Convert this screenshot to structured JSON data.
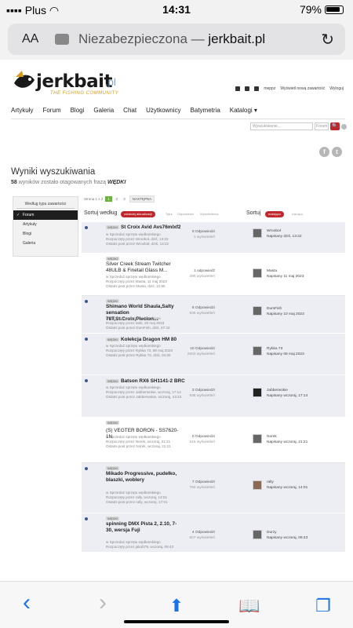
{
  "status": {
    "carrier": "Plus",
    "time": "14:31",
    "battery": "79%"
  },
  "browser": {
    "aa": "AA",
    "url_prefix": "Niezabezpieczona — ",
    "url_domain": "jerkbait.pl"
  },
  "site": {
    "logo": {
      "word": "jerkbait",
      "suffix": ".pl",
      "tagline": "THE FISHING COMMUNITY"
    },
    "toplinks": {
      "user": "meppz",
      "show_new": "Wyświetl nową zawartość",
      "logout": "Wyloguj"
    },
    "nav": [
      "Artykuły",
      "Forum",
      "Blogi",
      "Galeria",
      "Chat",
      "Użytkownicy",
      "Batymetria",
      "Katalogi ▾"
    ],
    "search": {
      "placeholder": "Wyszukiwanie...",
      "scope": "Forum",
      "button": "🔍"
    },
    "social": [
      "f",
      "t"
    ]
  },
  "results": {
    "title": "Wyniki wyszukiwania",
    "count": "58",
    "sub_text": " wyników zostało otagowanych frazą ",
    "phrase": "WĘDKI"
  },
  "filter": {
    "heading": "Według typu zawartości",
    "items": [
      "Forum",
      "Artykuły",
      "Blogi",
      "Galeria"
    ]
  },
  "pager": {
    "label": "Strona 1 z 3",
    "pages": [
      "1",
      "2",
      "3"
    ],
    "next": "NASTĘPNA"
  },
  "sort": {
    "label": "Sortuj według",
    "options": [
      "ostatniej aktualizacji",
      "Tytuł",
      "Odpowiedzi",
      "Wyświetlenia"
    ],
    "label2": "Sortuj",
    "options2": [
      "malejąco",
      "rosnąco"
    ]
  },
  "topics": [
    {
      "tag": "WĘDKI",
      "title": "St Croix Avid Avs76mlxf2",
      "meta": [
        "w Sprzedaż sprzętu wędkarskiego",
        "Rozpoczęty przez Wrooboł, dziś, 13:22",
        "Ostatni post przez Wrooboł, dziś, 13:22"
      ],
      "replies": "0 Odpowiedzi",
      "views": "1 wyświetleń",
      "last_user": "Wrooboł",
      "last_date": "Napisany dziś, 13:22"
    },
    {
      "tag": "WĘDKI",
      "title": "Silver Creek Stream Twitcher 48ULB & Finetail Glass M...",
      "meta": [
        "w Sprzedaż sprzętu wędkarskiego",
        "Rozpoczęty przez Masta, 11 maj 2023",
        "Ostatni post przez Masta, dziś, 12:55"
      ],
      "replies": "1 odpowiedź",
      "views": "490 wyświetleń",
      "last_user": "Masta",
      "last_date": "Napisany 11 maj 2023"
    },
    {
      "tag": "WĘDKI",
      "title": "Shimano World Shaula,Salty sensation 78T,St.Croix,Plecion...",
      "meta": [
        "w Sprzedaż sprzętu wędkarskiego",
        "Rozpoczęty przez tarik, 30 maj 2023",
        "Ostatni post przez DumFish, dziś, 07:43"
      ],
      "replies": "5 Odpowiedzi",
      "views": "935 wyświetleń",
      "last_user": "DumFish",
      "last_date": "Napisany 10 maj 2023"
    },
    {
      "tag": "WĘDKI",
      "title": "Kolekcja Dragon HM 80",
      "meta": [
        "w Sprzedaż sprzętu wędkarskiego",
        "Rozpoczęty przez Rybka 73, 08 maj 2023",
        "Ostatni post przez Rybka 73, dziś, 04:30"
      ],
      "replies": "10 Odpowiedzi",
      "views": "2602 wyświetleń",
      "last_user": "Rybka 73",
      "last_date": "Napisany 08 maj 2023"
    },
    {
      "tag": "WĘDKI",
      "title": "Batson RX6 SH1141-2 BRC",
      "meta": [
        "w Sprzedaż sprzętu wędkarskiego",
        "Rozpoczęty przez Jabberwokie, wczoraj, 17:14",
        "Ostatni post przez Jabberwokie, wczoraj, 23:24"
      ],
      "replies": "3 Odpowiedzi",
      "views": "838 wyświetleń",
      "last_user": "Jabberwokie",
      "last_date": "Napisany wczoraj, 17:14"
    },
    {
      "tag": "WĘDKI",
      "title": "(S) VEGTER BORON - SS7620-1N",
      "meta": [
        "w Sprzedaż sprzętu wędkarskiego",
        "Rozpoczęty przez Norek, wczoraj, 21:21",
        "Ostatni post przez Norek, wczoraj, 21:21"
      ],
      "replies": "0 Odpowiedzi",
      "views": "615 wyświetleń",
      "last_user": "Norek",
      "last_date": "Napisany wczoraj, 21:21"
    },
    {
      "tag": "WĘDKI",
      "title": "Mikado Progressive, pudełko, blaszki, woblery",
      "meta": [
        "w Sprzedaż sprzętu wędkarskiego",
        "Rozpoczęty przez rally, wczoraj, 14:01",
        "",
        "Ostatni post przez rally, wczoraj, 17:01"
      ],
      "replies": "7 Odpowiedzi",
      "views": "766 wyświetleń",
      "last_user": "rally",
      "last_date": "Napisany wczoraj, 14:01"
    },
    {
      "tag": "WĘDKI",
      "title": "spinning DMX Pista 2, 2.10, 7-30, wersja Fuji",
      "meta": [
        "w Sprzedaż sprzętu wędkarskiego",
        "Rozpoczęty przez jakub79, wczoraj, 09:43"
      ],
      "replies": "4 Odpowiedzi",
      "views": "507 wyświetleń",
      "last_user": "Durzy",
      "last_date": "Napisany wczoraj, 09:43"
    }
  ],
  "toolbar": {
    "back": "‹",
    "forward": "›",
    "share": "⬆",
    "bookmarks": "📖",
    "tabs": "❐"
  }
}
